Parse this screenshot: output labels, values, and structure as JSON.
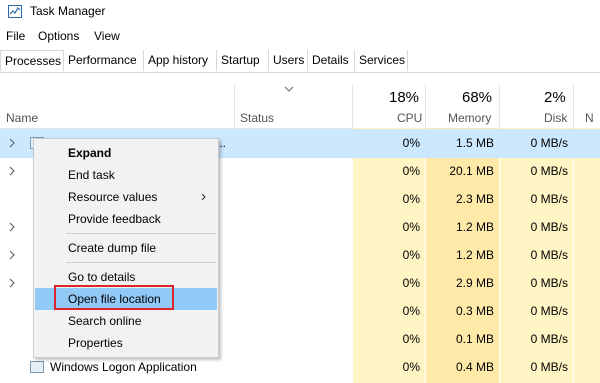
{
  "window": {
    "title": "Task Manager"
  },
  "menu": [
    "File",
    "Options",
    "View"
  ],
  "tabs": [
    "Processes",
    "Performance",
    "App history",
    "Startup",
    "Users",
    "Details",
    "Services"
  ],
  "active_tab": "Processes",
  "columns": {
    "name": "Name",
    "status": "Status",
    "cpu": {
      "pct": "18%",
      "label": "CPU"
    },
    "memory": {
      "pct": "68%",
      "label": "Memory"
    },
    "disk": {
      "pct": "2%",
      "label": "Disk"
    },
    "network": {
      "label": "N"
    }
  },
  "rows": [
    {
      "name": "",
      "cpu": "0%",
      "memory": "1.5 MB",
      "disk": "0 MB/s",
      "expandable": true,
      "selected": true,
      "name_truncated": "..."
    },
    {
      "name": "",
      "cpu": "0%",
      "memory": "20.1 MB",
      "disk": "0 MB/s",
      "expandable": true
    },
    {
      "name": "",
      "cpu": "0%",
      "memory": "2.3 MB",
      "disk": "0 MB/s",
      "expandable": false
    },
    {
      "name": "",
      "cpu": "0%",
      "memory": "1.2 MB",
      "disk": "0 MB/s",
      "expandable": true
    },
    {
      "name": "",
      "cpu": "0%",
      "memory": "1.2 MB",
      "disk": "0 MB/s",
      "expandable": true
    },
    {
      "name": "",
      "cpu": "0%",
      "memory": "2.9 MB",
      "disk": "0 MB/s",
      "expandable": true
    },
    {
      "name": "",
      "cpu": "0%",
      "memory": "0.3 MB",
      "disk": "0 MB/s",
      "expandable": false
    },
    {
      "name": "",
      "cpu": "0%",
      "memory": "0.1 MB",
      "disk": "0 MB/s",
      "expandable": false
    },
    {
      "name": "Windows Logon Application",
      "cpu": "0%",
      "memory": "0.4 MB",
      "disk": "0 MB/s",
      "expandable": false
    }
  ],
  "context_menu": {
    "items": [
      {
        "label": "Expand",
        "bold": true
      },
      {
        "label": "End task"
      },
      {
        "label": "Resource values",
        "submenu": true
      },
      {
        "label": "Provide feedback"
      },
      {
        "label": "Create dump file"
      },
      {
        "label": "Go to details"
      },
      {
        "label": "Open file location",
        "hover": true
      },
      {
        "label": "Search online"
      },
      {
        "label": "Properties"
      }
    ]
  },
  "colors": {
    "selected_row": "#cce8ff",
    "heat_cpu": "#fff4c4",
    "heat_mem": "#ffe9a8",
    "menu_hover": "#91c9f7",
    "annotation_box": "#d9262c"
  }
}
